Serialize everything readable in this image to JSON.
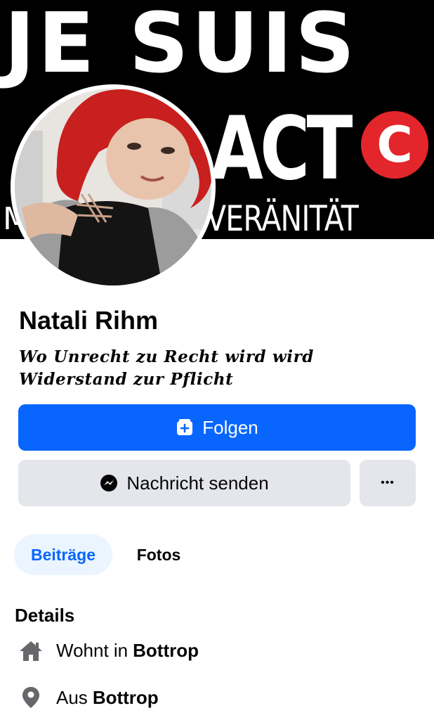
{
  "cover": {
    "line1": "JE SUIS",
    "line2": "ACT",
    "logo_letter": "C",
    "line3_left": "M",
    "line3": "VERÄNITÄT"
  },
  "profile": {
    "name": "Natali Rihm",
    "bio_line1": "Wo Unrecht zu Recht wird wird",
    "bio_line2": "Widerstand zur Pflicht"
  },
  "actions": {
    "follow_label": "Folgen",
    "message_label": "Nachricht senden",
    "more_label": "•••"
  },
  "tabs": [
    {
      "label": "Beiträge",
      "active": true
    },
    {
      "label": "Fotos",
      "active": false
    }
  ],
  "details": {
    "heading": "Details",
    "items": [
      {
        "icon": "home-icon",
        "prefix": "Wohnt in",
        "value": "Bottrop"
      },
      {
        "icon": "location-pin-icon",
        "prefix": "Aus",
        "value": "Bottrop"
      }
    ]
  },
  "colors": {
    "primary": "#0866ff",
    "secondary_button": "#e4e6eb",
    "active_tab_bg": "#ebf5ff",
    "cover_bg": "#000000",
    "logo_red": "#e2262b"
  }
}
